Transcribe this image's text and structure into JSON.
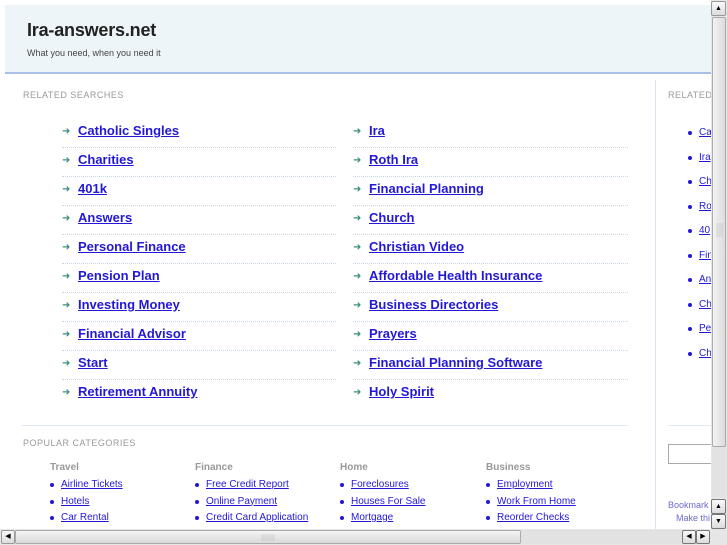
{
  "header": {
    "title": "Ira-answers.net",
    "tagline": "What you need, when you need it"
  },
  "related_searches": {
    "label": "RELATED SEARCHES",
    "arrow_icon": "➜",
    "left": [
      "Catholic Singles",
      "Charities",
      "401k",
      "Answers",
      "Personal Finance",
      "Pension Plan",
      "Investing Money",
      "Financial Advisor",
      "Start",
      "Retirement Annuity"
    ],
    "right": [
      "Ira",
      "Roth Ira",
      "Financial Planning",
      "Church",
      "Christian Video",
      "Affordable Health Insurance",
      "Business Directories",
      "Prayers",
      "Financial Planning Software",
      "Holy Spirit"
    ]
  },
  "popular_categories": {
    "label": "POPULAR CATEGORIES",
    "columns": [
      {
        "heading": "Travel",
        "items": [
          "Airline Tickets",
          "Hotels",
          "Car Rental"
        ]
      },
      {
        "heading": "Finance",
        "items": [
          "Free Credit Report",
          "Online Payment",
          "Credit Card Application"
        ]
      },
      {
        "heading": "Home",
        "items": [
          "Foreclosures",
          "Houses For Sale",
          "Mortgage"
        ]
      },
      {
        "heading": "Business",
        "items": [
          "Employment",
          "Work From Home",
          "Reorder Checks"
        ]
      }
    ]
  },
  "sidebar": {
    "label": "RELATED",
    "items": [
      "Ca",
      "Ira",
      "Ch",
      "Ro",
      "40",
      "Fin",
      "Ans",
      "Ch",
      "Pe",
      "Ch"
    ],
    "search_value": "",
    "bookmark_text": "Bookmark",
    "make_text": "Make thi"
  },
  "scrollbars": {
    "up_arrow": "▲",
    "down_arrow": "▼",
    "left_arrow": "◀",
    "right_arrow": "▶"
  },
  "colors": {
    "link": "#2318d6",
    "arrow": "#3b8e7e",
    "header_bg": "#eef5f8",
    "header_border": "#a8c0e8"
  }
}
